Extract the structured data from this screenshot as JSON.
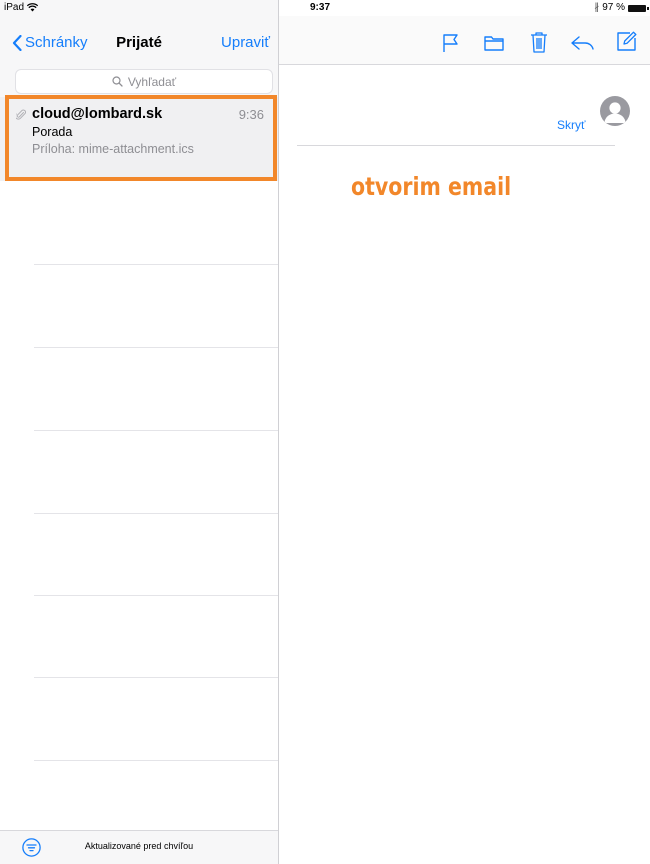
{
  "status_bar": {
    "device": "iPad",
    "time": "9:37",
    "battery": "97 %"
  },
  "sidebar": {
    "back_label": "Schránky",
    "title": "Prijaté",
    "edit_label": "Upraviť",
    "search_placeholder": "Vyhľadať",
    "footer_status": "Aktualizované pred chvíľou"
  },
  "messages": [
    {
      "from": "cloud@lombard.sk",
      "time": "9:36",
      "subject": "Porada",
      "preview": "Príloha: mime-attachment.ics",
      "has_attachment": true
    }
  ],
  "detail": {
    "hide_label": "Skryť",
    "toolbar_icons": [
      "flag-icon",
      "folder-icon",
      "trash-icon",
      "reply-icon",
      "compose-icon"
    ]
  },
  "annotation": {
    "text": "otvorim email",
    "color": "#f2872a"
  },
  "colors": {
    "accent": "#157efb",
    "highlight": "#f2872a"
  }
}
